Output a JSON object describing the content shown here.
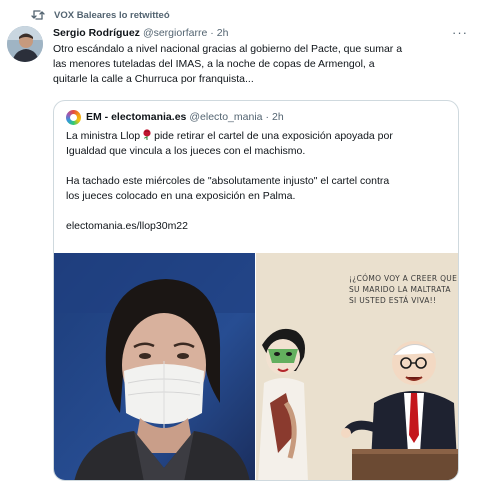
{
  "retweet": {
    "text": "VOX Baleares lo retwitteó",
    "icon": "retweet-icon"
  },
  "tweet": {
    "author_name": "Sergio Rodríguez",
    "handle": "@sergiorfarre",
    "separator": "·",
    "time": "2h",
    "text_lines": [
      "Otro escándalo a nivel nacional gracias al gobierno del Pacte, que sumar a",
      "las menores tuteladas del IMAS, a la noche de copas de Armengol, a",
      "quitarle la calle a Churruca por franquista..."
    ],
    "more_icon": "more-icon"
  },
  "quote": {
    "author_name": "EM - electomania.es",
    "handle": "@electo_mania",
    "separator": "·",
    "time": "2h",
    "lines": {
      "l1a": "La ministra Llop",
      "l1b": "pide retirar el cartel de una exposición apoyada por",
      "l2": "Igualdad que vincula a los jueces con el machismo.",
      "l3": "Ha tachado este miércoles de \"absolutamente injusto\" el cartel contra",
      "l4": "los jueces colocado en una exposición en Palma.",
      "l5": "electomania.es/llop30m22"
    },
    "emoji": "rose-icon",
    "cartoon_caption": [
      "¡¿CÓMO VOY A CREER QUE",
      "SU MARIDO LA MALTRATA",
      "SI USTED ESTÁ VIVA!!"
    ]
  },
  "colors": {
    "text": "#0f1419",
    "secondary": "#536471",
    "border": "#cfd9de"
  }
}
